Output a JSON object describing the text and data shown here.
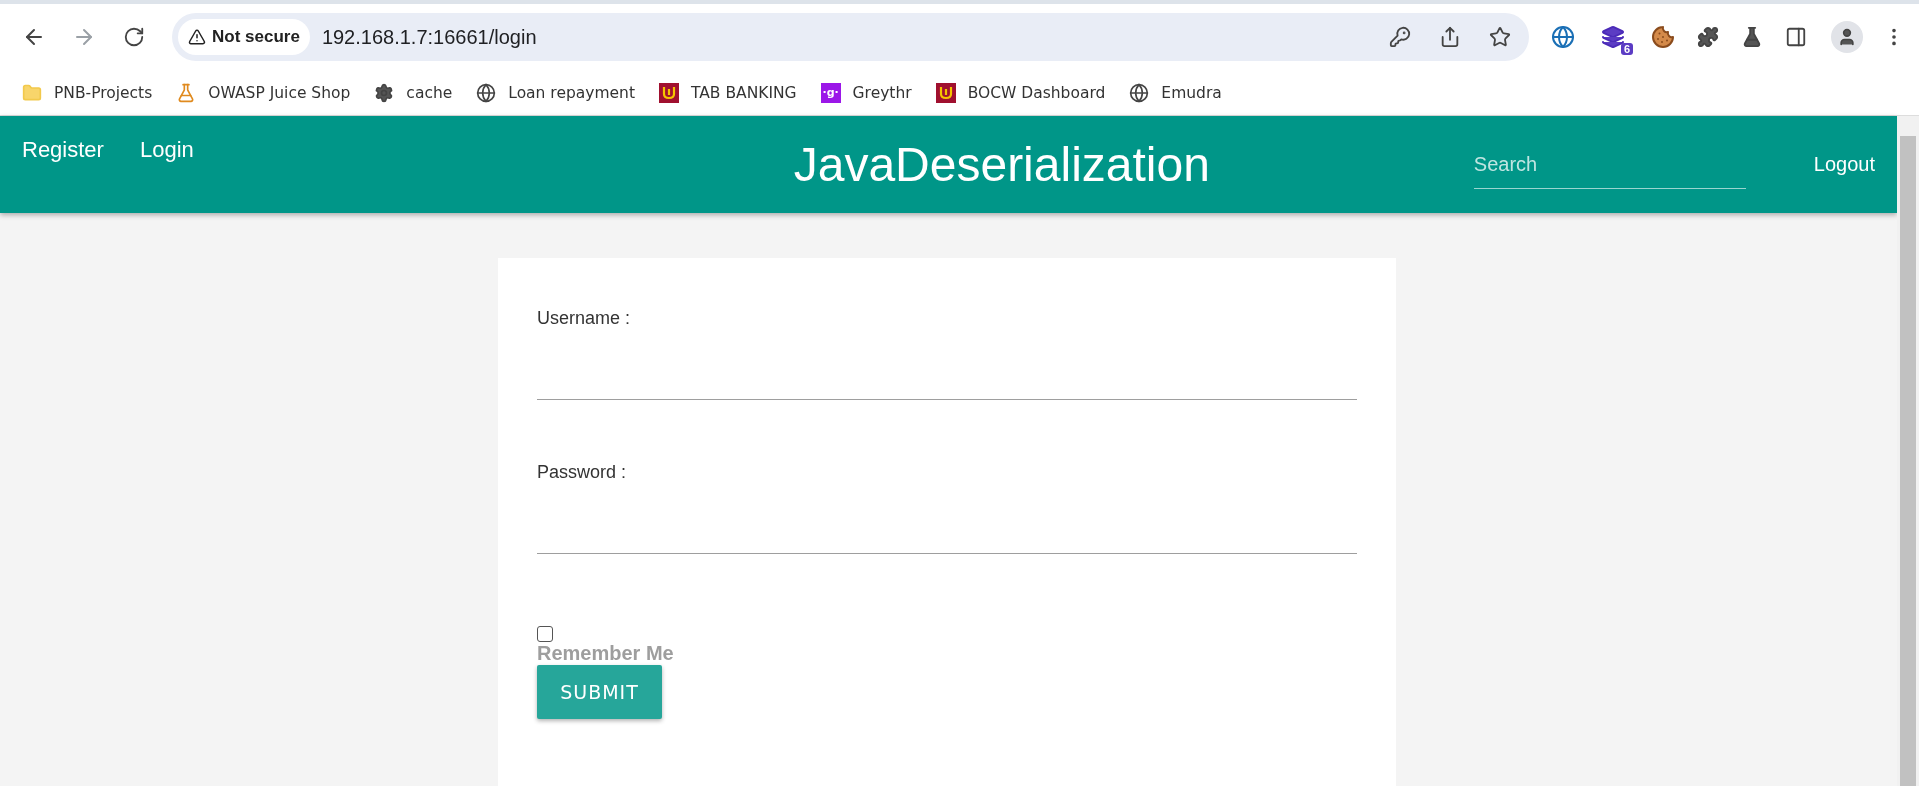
{
  "browser": {
    "security": "Not secure",
    "url": "192.168.1.7:16661/login",
    "extension_badge": "6",
    "bookmarks": [
      {
        "kind": "folder",
        "label": "PNB-Projects"
      },
      {
        "kind": "mascot",
        "label": "OWASP Juice Shop"
      },
      {
        "kind": "gear",
        "label": "cache"
      },
      {
        "kind": "globe",
        "label": "Loan repayment"
      },
      {
        "kind": "bank",
        "label": "TAB BANKING"
      },
      {
        "kind": "letter",
        "label": "Greythr",
        "glyph": "·g·"
      },
      {
        "kind": "bank",
        "label": "BOCW Dashboard"
      },
      {
        "kind": "globe",
        "label": "Emudra"
      }
    ]
  },
  "navbar": {
    "links": [
      "Register",
      "Login"
    ],
    "title": "JavaDeserialization",
    "search": {
      "placeholder": "Search"
    },
    "logout": "Logout"
  },
  "form": {
    "fields": [
      {
        "label": "Username :"
      },
      {
        "label": "Password :"
      }
    ],
    "remember": {
      "label": "Remember Me",
      "checked": false
    },
    "submit": "SUBMIT"
  }
}
